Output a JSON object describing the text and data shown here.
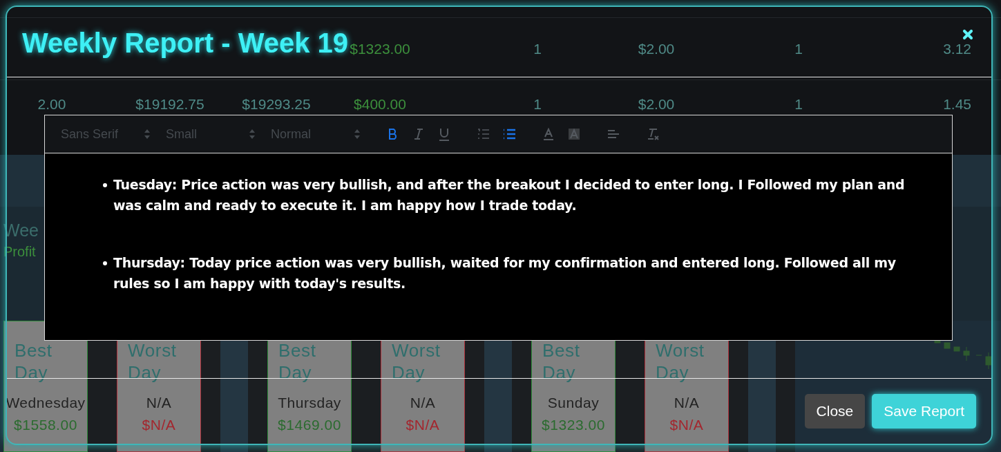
{
  "background_table": {
    "rows": [
      {
        "cells": [
          {
            "text": ""
          },
          {
            "text": ""
          },
          {
            "text": ""
          },
          {
            "text": "$1323.00",
            "kind": "profit"
          },
          {
            "text": "1",
            "kind": "plain"
          },
          {
            "text": "$2.00",
            "kind": "plain"
          },
          {
            "text": "1",
            "kind": "plain"
          },
          {
            "text": "3.12",
            "kind": "plain"
          }
        ]
      },
      {
        "cells": [
          {
            "text": "2.00",
            "kind": "plain"
          },
          {
            "text": "$19192.75",
            "kind": "plain"
          },
          {
            "text": "$19293.25",
            "kind": "plain"
          },
          {
            "text": "$400.00",
            "kind": "profit"
          },
          {
            "text": "1",
            "kind": "plain"
          },
          {
            "text": "$2.00",
            "kind": "plain"
          },
          {
            "text": "1",
            "kind": "plain"
          },
          {
            "text": "1.45",
            "kind": "plain"
          }
        ]
      }
    ]
  },
  "background_heading": {
    "title": "Wee",
    "subtitle": "Profit"
  },
  "day_cards": [
    {
      "kind": "best",
      "label": "Best Day",
      "day": "Wednesday",
      "amount": "$1558.00"
    },
    {
      "kind": "worst",
      "label": "Worst Day",
      "day": "N/A",
      "amount": "$N/A"
    },
    {
      "kind": "best",
      "label": "Best Day",
      "day": "Thursday",
      "amount": "$1469.00"
    },
    {
      "kind": "worst",
      "label": "Worst Day",
      "day": "N/A",
      "amount": "$N/A"
    },
    {
      "kind": "best",
      "label": "Best Day",
      "day": "Sunday",
      "amount": "$1323.00"
    },
    {
      "kind": "worst",
      "label": "Worst Day",
      "day": "N/A",
      "amount": "$N/A"
    }
  ],
  "modal": {
    "title": "Weekly Report - Week 19",
    "toolbar": {
      "pickers": [
        {
          "label": "Sans Serif"
        },
        {
          "label": "Small"
        },
        {
          "label": "Normal"
        }
      ],
      "tools": [
        {
          "kind": "bold",
          "active": true
        },
        {
          "kind": "italic",
          "active": false
        },
        {
          "kind": "underline",
          "active": false
        },
        {
          "kind": "ordered-list",
          "active": false
        },
        {
          "kind": "bullet-list",
          "active": true
        },
        {
          "kind": "text-color",
          "active": false
        },
        {
          "kind": "highlight",
          "active": false
        },
        {
          "kind": "align",
          "active": false
        },
        {
          "kind": "clear-format",
          "active": false
        }
      ]
    },
    "entries": [
      "Tuesday: Price action was very bullish, and after the breakout I decided to enter long. I Followed my plan and was calm and ready to execute it. I am happy how I trade today.",
      "Thursday: Today price action was very bullish, waited for my confirmation and entered long. Followed all my rules so I am happy with today's results."
    ],
    "buttons": [
      {
        "kind": "secondary",
        "label": "Close"
      },
      {
        "kind": "primary",
        "label": "Save Report"
      }
    ]
  }
}
